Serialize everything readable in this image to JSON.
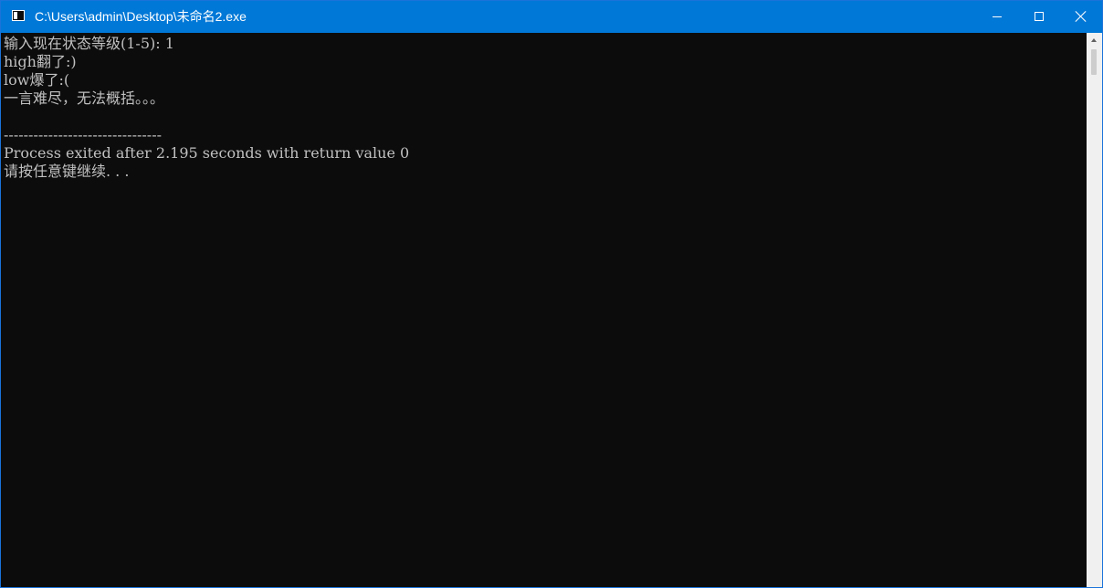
{
  "window": {
    "title": "C:\\Users\\admin\\Desktop\\未命名2.exe",
    "icon": "console-app-icon"
  },
  "controls": {
    "minimize": "minimize-icon",
    "maximize": "maximize-icon",
    "close": "close-icon"
  },
  "console": {
    "lines": [
      "输入现在状态等级(1-5): 1",
      "high翻了:)",
      "low爆了:(",
      "一言难尽，无法概括。。。",
      "",
      "--------------------------------",
      "Process exited after 2.195 seconds with return value 0",
      "请按任意键继续. . ."
    ]
  },
  "colors": {
    "titlebar": "#0078d7",
    "console_bg": "#0c0c0c",
    "console_text": "#c0c0c0"
  }
}
